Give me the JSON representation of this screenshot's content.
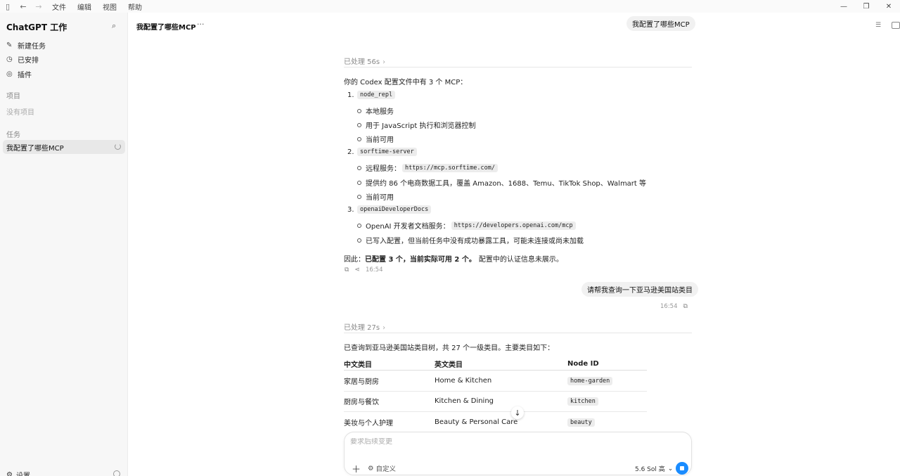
{
  "titlebar": {
    "menus": [
      "文件",
      "编辑",
      "视图",
      "帮助"
    ]
  },
  "sidebar": {
    "app_title": "ChatGPT 工作",
    "nav": [
      {
        "label": "新建任务",
        "icon": "edit-icon"
      },
      {
        "label": "已安排",
        "icon": "clock-icon"
      },
      {
        "label": "插件",
        "icon": "plugin-icon"
      }
    ],
    "projects_heading": "项目",
    "projects_empty": "没有项目",
    "tasks_heading": "任务",
    "active_task": "我配置了哪些MCP",
    "settings_label": "设置"
  },
  "header": {
    "title": "我配置了哪些MCP",
    "more": "···"
  },
  "chat": {
    "user_msg_1": "我配置了哪些MCP",
    "processed_1": "已处理 56s",
    "answer_intro": "你的 Codex 配置文件中有 3 个 MCP：",
    "mcps": [
      {
        "num": "1.",
        "name": "node_repl",
        "bullets": [
          "本地服务",
          "用于 JavaScript 执行和浏览器控制",
          "当前可用"
        ]
      },
      {
        "num": "2.",
        "name": "sorftime-server",
        "bullets": [
          "远程服务：",
          "提供约 86 个电商数据工具，覆盖 Amazon、1688、Temu、TikTok Shop、Walmart 等",
          "当前可用"
        ],
        "url": "https://mcp.sorftime.com/"
      },
      {
        "num": "3.",
        "name": "openaiDeveloperDocs",
        "bullets": [
          "OpenAI 开发者文档服务：",
          "已写入配置，但当前任务中没有成功暴露工具，可能未连接或尚未加载"
        ],
        "url": "https://developers.openai.com/mcp"
      }
    ],
    "summary_prefix": "因此：",
    "summary_bold": "已配置 3 个，当前实际可用 2 个。",
    "summary_suffix": "配置中的认证信息未展示。",
    "answer_time": "16:54",
    "user_msg_2": "请帮我查询一下亚马逊美国站类目",
    "user_msg_2_time": "16:54",
    "processed_2": "已处理 27s",
    "answer_2_intro": "已查询到亚马逊美国站类目树，共 27 个一级类目。主要类目如下：",
    "table": {
      "headers": [
        "中文类目",
        "英文类目",
        "Node ID"
      ],
      "rows": [
        [
          "家居与厨房",
          "Home & Kitchen",
          "home-garden"
        ],
        [
          "厨房与餐饮",
          "Kitchen & Dining",
          "kitchen"
        ],
        [
          "美妆与个人护理",
          "Beauty & Personal Care",
          "beauty"
        ]
      ]
    }
  },
  "composer": {
    "placeholder": "要求后续变更",
    "custom_label": "自定义",
    "model_label": "5.6 Sol 高"
  }
}
